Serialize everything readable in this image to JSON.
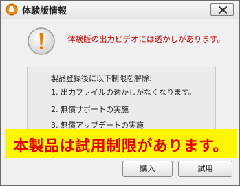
{
  "window": {
    "title": "体験版情報"
  },
  "dialog": {
    "message": "体験版の出力ビデオには透かしがあります。",
    "info_lines": [
      "製品登録後に以下制限を解除:",
      "1. 出力ファイルの透かしがなくなります。",
      "2. 無償サポートの実施",
      "3. 無償アップデートの実施"
    ]
  },
  "banner": {
    "text": "本製品は試用制限があります。"
  },
  "buttons": {
    "buy_label": "購入",
    "trial_label": "試用"
  },
  "colors": {
    "message": "#c00000",
    "banner_background": "#fff700",
    "banner_text": "#e60000",
    "app_icon": "#f08a1c",
    "warning_circle": "#e8e8e8",
    "warning_mark": "#e07b00"
  },
  "icons": {
    "app": "app-icon",
    "close": "close-icon",
    "warning": "warning-icon"
  }
}
